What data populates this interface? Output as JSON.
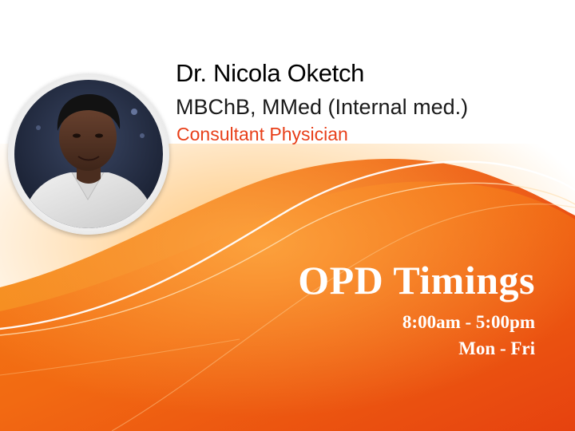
{
  "doctor": {
    "name": "Dr. Nicola Oketch",
    "qualifications": "MBChB, MMed (Internal med.)",
    "role": "Consultant Physician"
  },
  "opd": {
    "title": "OPD Timings",
    "hours": "8:00am - 5:00pm",
    "days": "Mon - Fri"
  },
  "colors": {
    "accent_orange": "#f26a12",
    "deep_orange": "#e8401a",
    "light_orange": "#f9a23a",
    "text_dark": "#000000",
    "text_light": "#ffffff"
  },
  "icons": {
    "photo": "doctor-portrait"
  }
}
